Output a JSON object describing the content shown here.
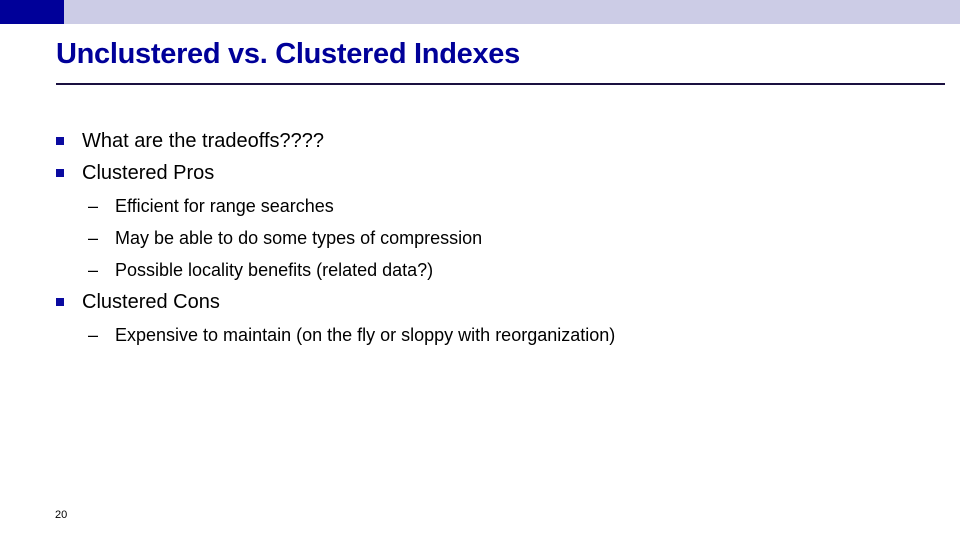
{
  "slide": {
    "title": "Unclustered vs. Clustered Indexes",
    "bullets": [
      {
        "text": "What are the tradeoffs????",
        "sub": []
      },
      {
        "text": "Clustered Pros",
        "sub": [
          "Efficient for range searches",
          "May be able to do some types of compression",
          "Possible locality benefits (related data?)"
        ]
      },
      {
        "text": "Clustered Cons",
        "sub": [
          "Expensive to maintain (on the fly or sloppy with reorganization)"
        ]
      }
    ],
    "dash_glyph": "–",
    "page_number": "20"
  },
  "colors": {
    "accent_dark": "#000099",
    "accent_light": "#CCCCE6",
    "title": "#000099"
  }
}
